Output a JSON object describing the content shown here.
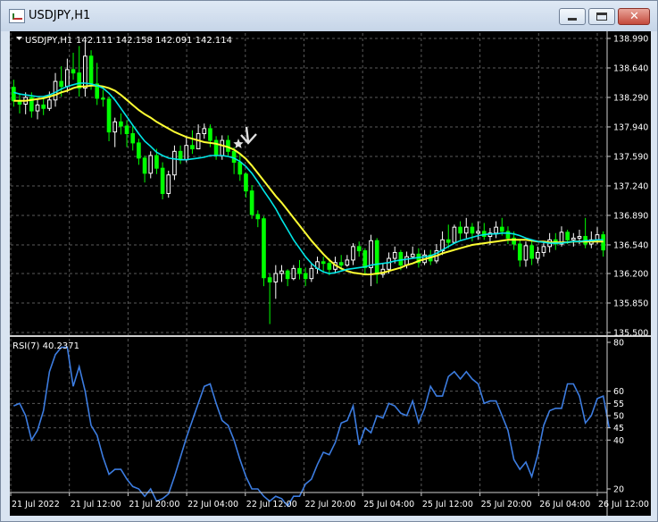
{
  "window": {
    "title": "USDJPY,H1"
  },
  "price_header": {
    "symbol": "USDJPY,H1",
    "ohlc": "142.111 142.158 142.091 142.114"
  },
  "rsi_header": "RSI(7) 40.2371",
  "colors": {
    "bull": "#ffffff",
    "bear": "#00ff00",
    "ma_fast": "#00e6e6",
    "ma_slow": "#ffff33",
    "rsi": "#3c7ce0",
    "grid": "#5a5a5a",
    "text": "#ffffff"
  },
  "icons": {
    "minimize": "minimize-icon",
    "maximize": "maximize-icon",
    "close": "close-icon",
    "arrow": "down-arrow-icon",
    "star": "star-icon"
  },
  "chart_data": [
    {
      "type": "candlestick",
      "title": "USDJPY,H1",
      "ylim": [
        135.5,
        138.99
      ],
      "yticks": [
        "138.990",
        "138.640",
        "138.290",
        "137.940",
        "137.590",
        "137.240",
        "136.890",
        "136.540",
        "136.200",
        "135.850",
        "135.500"
      ],
      "xticks": [
        "21 Jul 2022",
        "21 Jul 12:00",
        "21 Jul 20:00",
        "22 Jul 04:00",
        "22 Jul 12:00",
        "22 Jul 20:00",
        "25 Jul 04:00",
        "25 Jul 12:00",
        "25 Jul 20:00",
        "26 Jul 04:00",
        "26 Jul 12:00"
      ],
      "candles": [
        [
          138.41,
          138.25,
          138.5,
          138.18
        ],
        [
          138.25,
          138.21,
          138.34,
          138.1
        ],
        [
          138.21,
          138.29,
          138.35,
          138.09
        ],
        [
          138.29,
          138.13,
          138.35,
          138.05
        ],
        [
          138.13,
          138.2,
          138.28,
          138.03
        ],
        [
          138.2,
          138.16,
          138.3,
          138.08
        ],
        [
          138.16,
          138.26,
          138.36,
          138.13
        ],
        [
          138.26,
          138.48,
          138.58,
          138.18
        ],
        [
          138.48,
          138.42,
          138.66,
          138.3
        ],
        [
          138.42,
          138.62,
          138.75,
          138.35
        ],
        [
          138.62,
          138.58,
          138.82,
          138.5
        ],
        [
          138.58,
          138.4,
          138.9,
          138.3
        ],
        [
          138.4,
          138.78,
          138.95,
          138.3
        ],
        [
          138.78,
          138.45,
          138.85,
          138.38
        ],
        [
          138.45,
          138.28,
          138.7,
          138.2
        ],
        [
          138.28,
          138.27,
          138.38,
          138.18
        ],
        [
          138.27,
          137.88,
          138.3,
          137.77
        ],
        [
          137.88,
          138.0,
          138.05,
          137.7
        ],
        [
          138.0,
          137.95,
          138.1,
          137.85
        ],
        [
          137.95,
          137.86,
          138.02,
          137.7
        ],
        [
          137.86,
          137.75,
          137.96,
          137.66
        ],
        [
          137.75,
          137.57,
          137.8,
          137.49
        ],
        [
          137.57,
          137.39,
          137.6,
          137.28
        ],
        [
          137.39,
          137.6,
          137.65,
          137.33
        ],
        [
          137.6,
          137.45,
          137.68,
          137.38
        ],
        [
          137.45,
          137.15,
          137.52,
          137.08
        ],
        [
          137.15,
          137.37,
          137.42,
          137.1
        ],
        [
          137.37,
          137.65,
          137.72,
          137.31
        ],
        [
          137.65,
          137.55,
          137.72,
          137.5
        ],
        [
          137.55,
          137.72,
          137.82,
          137.52
        ],
        [
          137.72,
          137.68,
          137.9,
          137.62
        ],
        [
          137.68,
          137.86,
          137.97,
          137.68
        ],
        [
          137.86,
          137.92,
          137.98,
          137.8
        ],
        [
          137.92,
          137.78,
          137.97,
          137.7
        ],
        [
          137.78,
          137.6,
          137.83,
          137.55
        ],
        [
          137.6,
          137.78,
          137.84,
          137.55
        ],
        [
          137.78,
          137.65,
          137.84,
          137.6
        ],
        [
          137.65,
          137.52,
          137.7,
          137.38
        ],
        [
          137.52,
          137.38,
          137.62,
          137.3
        ],
        [
          137.38,
          137.18,
          137.4,
          137.1
        ],
        [
          137.18,
          136.9,
          137.25,
          136.85
        ],
        [
          136.9,
          136.85,
          136.95,
          136.75
        ],
        [
          136.85,
          136.15,
          136.88,
          136.05
        ],
        [
          136.15,
          136.1,
          136.2,
          135.6
        ],
        [
          136.1,
          136.2,
          136.3,
          135.9
        ],
        [
          136.2,
          136.23,
          136.3,
          136.1
        ],
        [
          136.23,
          136.14,
          136.25,
          136.05
        ],
        [
          136.14,
          136.26,
          136.3,
          136.12
        ],
        [
          136.26,
          136.2,
          136.36,
          136.13
        ],
        [
          136.2,
          136.14,
          136.27,
          136.05
        ],
        [
          136.14,
          136.26,
          136.32,
          136.1
        ],
        [
          136.26,
          136.34,
          136.4,
          136.2
        ],
        [
          136.34,
          136.32,
          136.4,
          136.22
        ],
        [
          136.32,
          136.25,
          136.38,
          136.18
        ],
        [
          136.25,
          136.33,
          136.4,
          136.2
        ],
        [
          136.33,
          136.3,
          136.42,
          136.24
        ],
        [
          136.3,
          136.36,
          136.42,
          136.28
        ],
        [
          136.36,
          136.52,
          136.56,
          136.3
        ],
        [
          136.52,
          136.47,
          136.58,
          136.4
        ],
        [
          136.47,
          136.27,
          136.5,
          136.2
        ],
        [
          136.27,
          136.59,
          136.66,
          136.05
        ],
        [
          136.59,
          136.19,
          136.62,
          136.08
        ],
        [
          136.19,
          136.25,
          136.32,
          136.15
        ],
        [
          136.25,
          136.38,
          136.45,
          136.2
        ],
        [
          136.38,
          136.45,
          136.52,
          136.32
        ],
        [
          136.45,
          136.3,
          136.48,
          136.24
        ],
        [
          136.3,
          136.4,
          136.46,
          136.26
        ],
        [
          136.4,
          136.43,
          136.52,
          136.38
        ],
        [
          136.43,
          136.33,
          136.5,
          136.27
        ],
        [
          136.33,
          136.42,
          136.48,
          136.3
        ],
        [
          136.42,
          136.35,
          136.48,
          136.3
        ],
        [
          136.35,
          136.47,
          136.55,
          136.32
        ],
        [
          136.47,
          136.6,
          136.7,
          136.42
        ],
        [
          136.6,
          136.57,
          136.78,
          136.5
        ],
        [
          136.57,
          136.75,
          136.78,
          136.55
        ],
        [
          136.75,
          136.68,
          136.82,
          136.6
        ],
        [
          136.68,
          136.75,
          136.86,
          136.62
        ],
        [
          136.75,
          136.68,
          136.8,
          136.58
        ],
        [
          136.68,
          136.7,
          136.82,
          136.6
        ],
        [
          136.7,
          136.64,
          136.8,
          136.6
        ],
        [
          136.64,
          136.68,
          136.74,
          136.54
        ],
        [
          136.68,
          136.75,
          136.82,
          136.62
        ],
        [
          136.75,
          136.7,
          136.86,
          136.65
        ],
        [
          136.7,
          136.62,
          136.76,
          136.55
        ],
        [
          136.62,
          136.55,
          136.7,
          136.48
        ],
        [
          136.55,
          136.36,
          136.6,
          136.28
        ],
        [
          136.36,
          136.53,
          136.58,
          136.28
        ],
        [
          136.53,
          136.38,
          136.58,
          136.3
        ],
        [
          136.38,
          136.45,
          136.52,
          136.32
        ],
        [
          136.45,
          136.52,
          136.58,
          136.4
        ],
        [
          136.52,
          136.6,
          136.68,
          136.45
        ],
        [
          136.6,
          136.55,
          136.68,
          136.48
        ],
        [
          136.55,
          136.69,
          136.76,
          136.52
        ],
        [
          136.69,
          136.6,
          136.72,
          136.55
        ],
        [
          136.6,
          136.62,
          136.68,
          136.52
        ],
        [
          136.62,
          136.64,
          136.72,
          136.55
        ],
        [
          136.64,
          136.55,
          136.86,
          136.5
        ],
        [
          136.55,
          136.6,
          136.7,
          136.5
        ],
        [
          136.6,
          136.66,
          136.75,
          136.55
        ],
        [
          136.66,
          136.48,
          136.7,
          136.4
        ]
      ],
      "ma_fast": [
        138.35,
        138.33,
        138.32,
        138.31,
        138.3,
        138.3,
        138.32,
        138.35,
        138.39,
        138.42,
        138.44,
        138.46,
        138.46,
        138.45,
        138.43,
        138.4,
        138.34,
        138.26,
        138.16,
        138.06,
        137.96,
        137.86,
        137.77,
        137.71,
        137.64,
        137.6,
        137.57,
        137.56,
        137.55,
        137.55,
        137.56,
        137.57,
        137.58,
        137.6,
        137.6,
        137.6,
        137.59,
        137.57,
        137.53,
        137.47,
        137.39,
        137.29,
        137.18,
        137.08,
        136.97,
        136.84,
        136.72,
        136.6,
        136.5,
        136.4,
        136.32,
        136.26,
        136.22,
        136.2,
        136.21,
        136.23,
        136.25,
        136.26,
        136.27,
        136.28,
        136.3,
        136.31,
        136.32,
        136.33,
        136.35,
        136.36,
        136.37,
        136.38,
        136.39,
        136.4,
        136.41,
        136.44,
        136.48,
        136.52,
        136.56,
        136.59,
        136.61,
        136.63,
        136.65,
        136.66,
        136.67,
        136.67,
        136.68,
        136.68,
        136.67,
        136.65,
        136.62,
        136.6,
        136.58,
        136.57,
        136.56,
        136.56,
        136.56,
        136.57,
        136.58,
        136.58,
        136.59,
        136.59,
        136.6,
        136.6
      ],
      "ma_slow": [
        138.25,
        138.25,
        138.25,
        138.26,
        138.27,
        138.28,
        138.3,
        138.32,
        138.35,
        138.37,
        138.4,
        138.42,
        138.42,
        138.43,
        138.43,
        138.42,
        138.4,
        138.37,
        138.32,
        138.26,
        138.2,
        138.14,
        138.09,
        138.05,
        138.0,
        137.96,
        137.92,
        137.88,
        137.85,
        137.82,
        137.8,
        137.78,
        137.76,
        137.75,
        137.74,
        137.72,
        137.7,
        137.67,
        137.62,
        137.56,
        137.48,
        137.39,
        137.3,
        137.21,
        137.12,
        137.04,
        136.95,
        136.86,
        136.77,
        136.68,
        136.59,
        136.51,
        136.43,
        136.36,
        136.3,
        136.26,
        136.23,
        136.21,
        136.2,
        136.19,
        136.19,
        136.2,
        136.21,
        136.23,
        136.25,
        136.27,
        136.3,
        136.32,
        136.35,
        136.37,
        136.39,
        136.41,
        136.44,
        136.46,
        136.48,
        136.5,
        136.52,
        136.54,
        136.55,
        136.56,
        136.57,
        136.58,
        136.59,
        136.6,
        136.6,
        136.6,
        136.6,
        136.59,
        136.58,
        136.58,
        136.57,
        136.57,
        136.57,
        136.57,
        136.58,
        136.58,
        136.58,
        136.58,
        136.58,
        136.58
      ]
    },
    {
      "type": "line",
      "title": "RSI(7) 40.2371",
      "ylim": [
        20,
        80
      ],
      "yticks": [
        80,
        60,
        55,
        50,
        45,
        40,
        20
      ],
      "values": [
        54,
        55,
        50,
        40,
        44,
        52,
        68,
        75,
        78,
        78,
        62,
        70,
        60,
        46,
        42,
        33,
        26,
        28,
        28,
        24,
        21,
        20,
        17,
        20,
        15,
        16,
        18,
        25,
        33,
        41,
        48,
        55,
        62,
        63,
        55,
        48,
        46,
        40,
        32,
        25,
        20,
        20,
        17,
        15,
        17,
        16,
        13,
        17,
        17,
        22,
        24,
        30,
        35,
        34,
        39,
        47,
        48,
        54,
        38,
        45,
        43,
        50,
        49,
        55,
        54,
        51,
        50,
        56,
        47,
        53,
        62,
        58,
        58,
        66,
        68,
        65,
        68,
        65,
        63,
        55,
        56,
        56,
        50,
        44,
        32,
        28,
        31,
        25,
        34,
        46,
        52,
        53,
        53,
        63,
        63,
        58,
        47,
        50,
        57,
        58,
        45
      ]
    }
  ]
}
